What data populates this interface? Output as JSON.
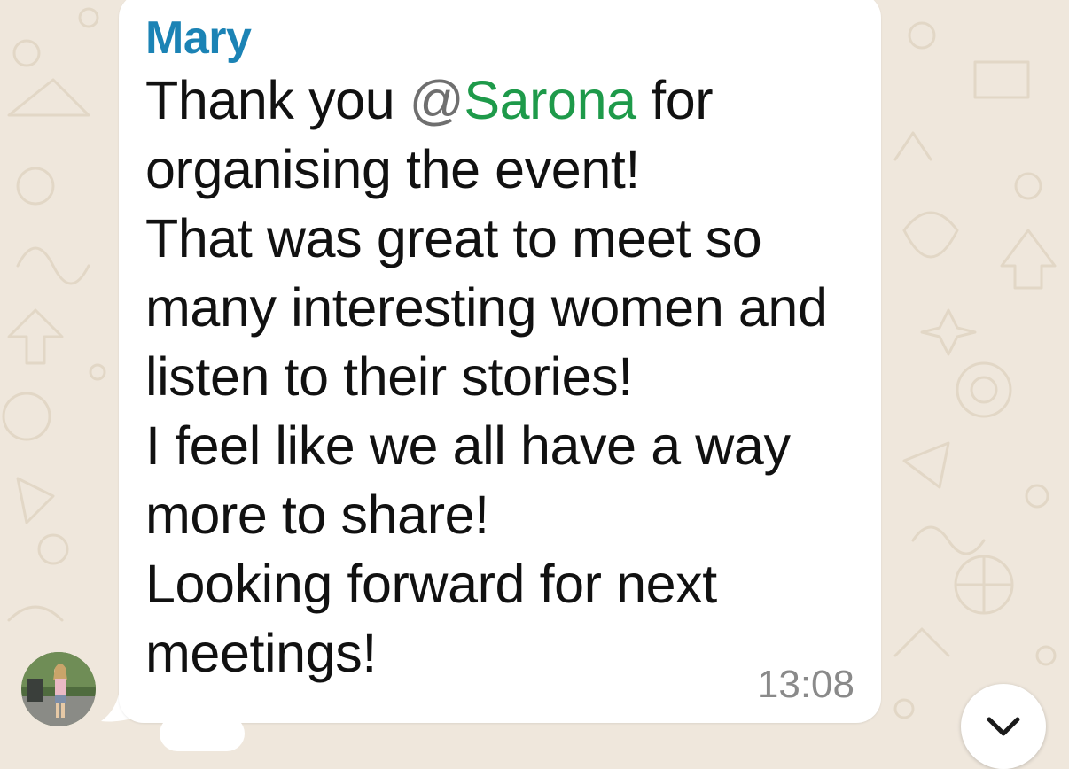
{
  "message": {
    "sender": "Mary",
    "mention_prefix": "Thank you ",
    "mention_at": "@",
    "mention_name": "Sarona",
    "after_mention": " for",
    "body": "organising the event!\nThat was great to meet so\nmany interesting women and\nlisten to their stories!\nI feel like we all have a way\nmore to share!\nLooking forward for next\nmeetings!",
    "timestamp": "13:08"
  },
  "icons": {
    "avatar": "avatar",
    "scroll_down": "chevron-down-icon"
  },
  "colors": {
    "background": "#efe7dc",
    "sender": "#1b83b5",
    "mention": "#1e9a4a",
    "timestamp": "#8a8a8a"
  }
}
